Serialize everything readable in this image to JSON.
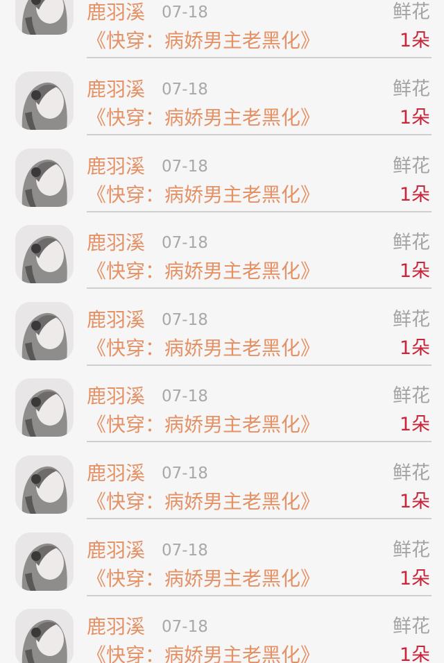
{
  "gift_list": {
    "items": [
      {
        "user_name": "鹿羽溪",
        "date": "07-18",
        "book_title": "《快穿：病娇男主老黑化》",
        "gift_type": "鲜花",
        "gift_count": "1朵",
        "avatar_icon": "user-avatar-icon"
      },
      {
        "user_name": "鹿羽溪",
        "date": "07-18",
        "book_title": "《快穿：病娇男主老黑化》",
        "gift_type": "鲜花",
        "gift_count": "1朵",
        "avatar_icon": "user-avatar-icon"
      },
      {
        "user_name": "鹿羽溪",
        "date": "07-18",
        "book_title": "《快穿：病娇男主老黑化》",
        "gift_type": "鲜花",
        "gift_count": "1朵",
        "avatar_icon": "user-avatar-icon"
      },
      {
        "user_name": "鹿羽溪",
        "date": "07-18",
        "book_title": "《快穿：病娇男主老黑化》",
        "gift_type": "鲜花",
        "gift_count": "1朵",
        "avatar_icon": "user-avatar-icon"
      },
      {
        "user_name": "鹿羽溪",
        "date": "07-18",
        "book_title": "《快穿：病娇男主老黑化》",
        "gift_type": "鲜花",
        "gift_count": "1朵",
        "avatar_icon": "user-avatar-icon"
      },
      {
        "user_name": "鹿羽溪",
        "date": "07-18",
        "book_title": "《快穿：病娇男主老黑化》",
        "gift_type": "鲜花",
        "gift_count": "1朵",
        "avatar_icon": "user-avatar-icon"
      },
      {
        "user_name": "鹿羽溪",
        "date": "07-18",
        "book_title": "《快穿：病娇男主老黑化》",
        "gift_type": "鲜花",
        "gift_count": "1朵",
        "avatar_icon": "user-avatar-icon"
      },
      {
        "user_name": "鹿羽溪",
        "date": "07-18",
        "book_title": "《快穿：病娇男主老黑化》",
        "gift_type": "鲜花",
        "gift_count": "1朵",
        "avatar_icon": "user-avatar-icon"
      },
      {
        "user_name": "鹿羽溪",
        "date": "07-18",
        "book_title": "《快穿：病娇男主老黑化》",
        "gift_type": "鲜花",
        "gift_count": "1朵",
        "avatar_icon": "user-avatar-icon"
      }
    ]
  },
  "colors": {
    "background": "#f7f6f6",
    "name_accent": "#e49166",
    "count_red": "#c7253a",
    "muted_gray": "#a8a8a8",
    "divider": "#cfcfcf"
  }
}
